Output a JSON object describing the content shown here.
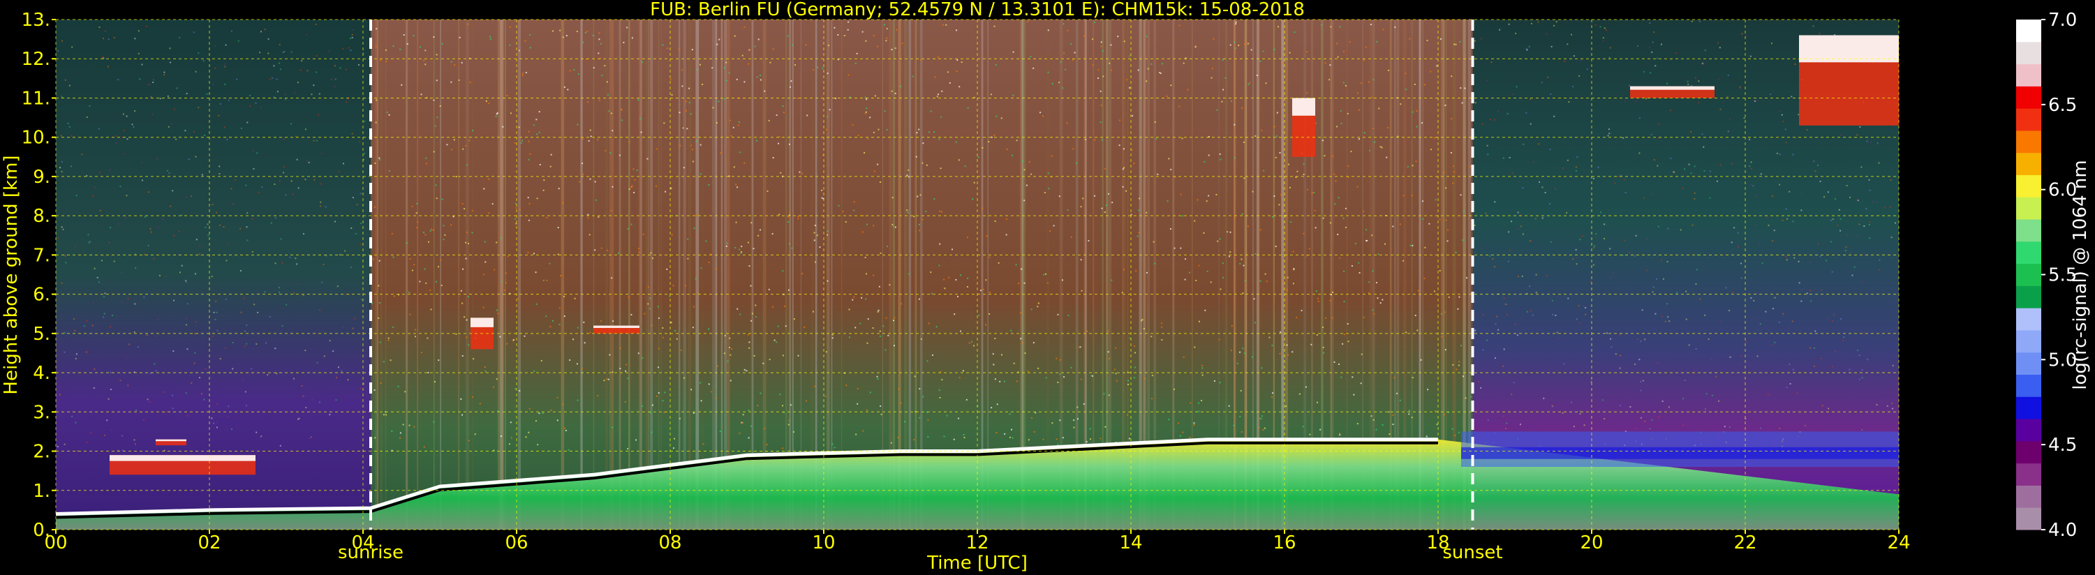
{
  "chart_data": {
    "type": "heatmap",
    "title": "FUB: Berlin FU (Germany; 52.4579 N / 13.3101 E):    CHM15k: 15-08-2018",
    "xlabel": "Time [UTC]",
    "ylabel": "Height above ground [km]",
    "colorbar_label": "log(rc-signal) @ 1064 nm",
    "xlim": [
      0,
      24
    ],
    "ylim": [
      0,
      13
    ],
    "x_ticks": [
      0,
      2,
      4,
      6,
      8,
      10,
      12,
      14,
      16,
      18,
      20,
      22,
      24
    ],
    "x_tick_labels": [
      "00",
      "02",
      "04",
      "06",
      "08",
      "10",
      "12",
      "14",
      "16",
      "18",
      "20",
      "22",
      "24"
    ],
    "y_ticks": [
      0,
      1,
      2,
      3,
      4,
      5,
      6,
      7,
      8,
      9,
      10,
      11,
      12,
      13
    ],
    "y_tick_labels": [
      "0.",
      "1.",
      "2.",
      "3.",
      "4.",
      "5.",
      "6.",
      "7.",
      "8.",
      "9.",
      "10.",
      "11.",
      "12.",
      "13."
    ],
    "colorbar_range": [
      4.0,
      7.0
    ],
    "colorbar_ticks": [
      4.0,
      4.5,
      5.0,
      5.5,
      6.0,
      6.5,
      7.0
    ],
    "colorbar_tick_labels": [
      "4.0",
      "4.5",
      "5.0",
      "5.5",
      "6.0",
      "6.5",
      "7.0"
    ],
    "colormap": [
      "#a98ea9",
      "#9e6f9e",
      "#8a2f8a",
      "#6e006e",
      "#5a00a0",
      "#1010e0",
      "#3a5ef0",
      "#6f8ff5",
      "#8fa9f8",
      "#b0c0fa",
      "#0aa04a",
      "#1cc050",
      "#30d870",
      "#7ee08a",
      "#c8f050",
      "#f8f030",
      "#f8b000",
      "#f87800",
      "#f03010",
      "#f00000",
      "#f0c0c8",
      "#e8e0e0",
      "#ffffff"
    ],
    "grid": true,
    "grid_color": "#ffff00",
    "text_color": "#ffff00",
    "markers": [
      {
        "label": "sunrise",
        "time": 4.1
      },
      {
        "label": "sunset",
        "time": 18.45
      }
    ],
    "layers": {
      "boundary_layer_top_km": [
        {
          "time": 0.0,
          "height": 0.4
        },
        {
          "time": 2.0,
          "height": 0.5
        },
        {
          "time": 4.1,
          "height": 0.55
        },
        {
          "time": 5.0,
          "height": 1.1
        },
        {
          "time": 7.0,
          "height": 1.4
        },
        {
          "time": 9.0,
          "height": 1.9
        },
        {
          "time": 11.0,
          "height": 2.0
        },
        {
          "time": 12.0,
          "height": 2.0
        },
        {
          "time": 13.0,
          "height": 2.1
        },
        {
          "time": 14.0,
          "height": 2.2
        },
        {
          "time": 15.0,
          "height": 2.3
        },
        {
          "time": 17.0,
          "height": 2.3
        },
        {
          "time": 18.0,
          "height": 2.3
        }
      ],
      "cloud_patches_km": [
        {
          "t0": 0.7,
          "t1": 2.6,
          "h0": 1.4,
          "h1": 1.9
        },
        {
          "t0": 1.3,
          "t1": 1.7,
          "h0": 2.15,
          "h1": 2.3
        },
        {
          "t0": 5.4,
          "t1": 5.7,
          "h0": 4.6,
          "h1": 5.4
        },
        {
          "t0": 7.0,
          "t1": 7.6,
          "h0": 5.0,
          "h1": 5.2
        },
        {
          "t0": 16.1,
          "t1": 16.4,
          "h0": 9.5,
          "h1": 11.0
        },
        {
          "t0": 20.5,
          "t1": 21.6,
          "h0": 11.0,
          "h1": 11.3
        },
        {
          "t0": 22.7,
          "t1": 24.0,
          "h0": 10.3,
          "h1": 12.6
        }
      ]
    }
  }
}
